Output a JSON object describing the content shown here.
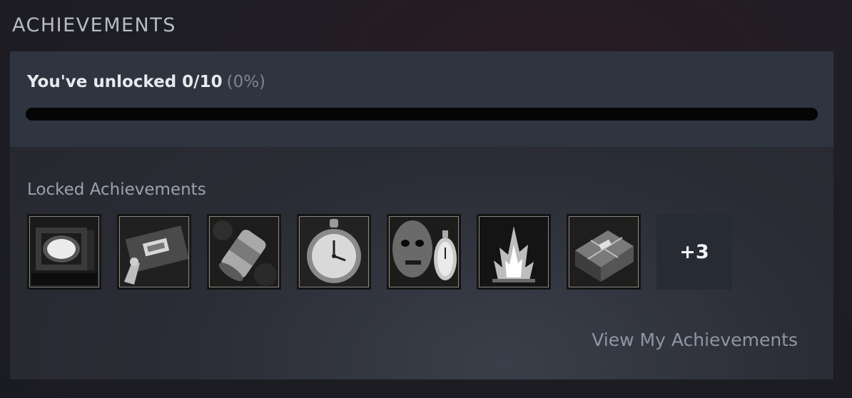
{
  "section": {
    "title": "ACHIEVEMENTS"
  },
  "progress": {
    "label": "You've unlocked 0/10",
    "percent_text": "(0%)",
    "unlocked": 0,
    "total": 10,
    "fraction": 0
  },
  "locked": {
    "label": "Locked Achievements",
    "icons": [
      {
        "icon": "glowing-tv-icon"
      },
      {
        "icon": "vhs-tape-icon"
      },
      {
        "icon": "can-icon"
      },
      {
        "icon": "pocket-watch-icon"
      },
      {
        "icon": "face-and-watch-icon"
      },
      {
        "icon": "campfire-icon"
      },
      {
        "icon": "package-icon"
      }
    ],
    "more_label": "+3"
  },
  "view_link": {
    "label": "View My Achievements"
  },
  "colors": {
    "panel_top": "#2f3540",
    "progress_track": "#050505",
    "title_text": "#b6bcc6",
    "link_text": "#8f96a2"
  }
}
